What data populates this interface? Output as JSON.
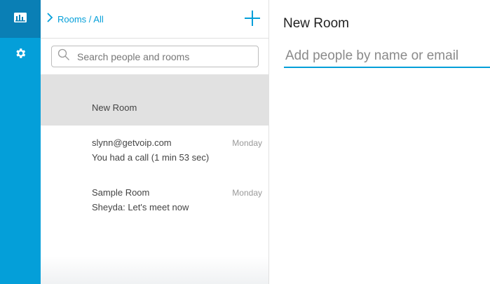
{
  "rail": {
    "items": [
      {
        "icon": "rooms-icon",
        "active": true
      },
      {
        "icon": "gear-icon",
        "active": false
      }
    ],
    "accent": "#049fd9",
    "active_bg": "#0a7fb5"
  },
  "list": {
    "breadcrumb": "Rooms / All",
    "search": {
      "placeholder": "Search people and rooms",
      "value": ""
    },
    "rooms": [
      {
        "name": "New Room",
        "subtitle": "",
        "day": "",
        "selected": true
      },
      {
        "name": "slynn@getvoip.com",
        "subtitle": "You had a call (1 min 53 sec)",
        "day": "Monday",
        "selected": false
      },
      {
        "name": "Sample Room",
        "subtitle": "Sheyda: Let's meet now",
        "day": "Monday",
        "selected": false
      }
    ]
  },
  "main": {
    "title": "New Room",
    "add_people": {
      "placeholder": "Add people by name or email",
      "value": ""
    }
  }
}
